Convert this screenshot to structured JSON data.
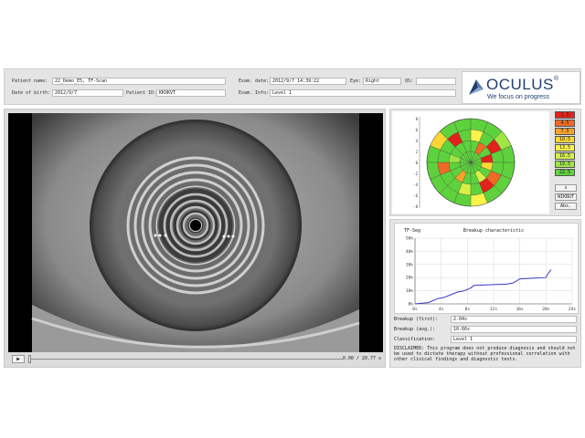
{
  "header": {
    "patient_name_label": "Patient name:",
    "patient_name": "22_Demo_E5, TF-Scan",
    "dob_label": "Date of birth:",
    "dob": "2012/9/7",
    "patient_id_label": "Patient ID:",
    "patient_id": "KKOKVT",
    "exam_date_label": "Exam. date:",
    "exam_date": "2012/9/7 14:39:22",
    "eye_label": "Eye:",
    "eye": "Right",
    "qs_label": "QS:",
    "qs": "",
    "exam_info_label": "Exam. Info:",
    "exam_info": "Level 1"
  },
  "logo": {
    "name": "OCULUS",
    "registered": "®",
    "slogan": "We focus on progress"
  },
  "video": {
    "play_symbol": "▶",
    "time": "0.00 / 20.77 s",
    "progress": 0
  },
  "topography": {
    "legend": [
      {
        "label": "1.5",
        "color": "#e2231a"
      },
      {
        "label": "4.5",
        "color": "#f06a25"
      },
      {
        "label": "7.5",
        "color": "#f6a12c"
      },
      {
        "label": "10.5",
        "color": "#fcd734"
      },
      {
        "label": "13.5",
        "color": "#fbf24a"
      },
      {
        "label": "16.5",
        "color": "#d6ef45"
      },
      {
        "label": "19.5",
        "color": "#9ee543"
      },
      {
        "label": "22.5",
        "color": "#5ed23c"
      }
    ],
    "buttons": [
      "s",
      "NIKBUT",
      "Abs."
    ],
    "axis_ticks": [
      "8",
      "6",
      "4",
      "2",
      "0",
      "-2",
      "-4",
      "-6",
      "-8"
    ]
  },
  "breakup": {
    "tag": "TF-Seg",
    "title": "Breakup characteristic",
    "first_label": "Breakup (first):",
    "first_value": "2.04s",
    "avg_label": "Breakup (avg.):",
    "avg_value": "10.66s",
    "class_label": "Classification:",
    "class_value": "Level 1",
    "disclaimer": "DISCLAIMER: This program does not produce diagnosis and should not be used to dictate therapy without professional correlation with other clinical findings and diagnostic tests."
  },
  "chart_data": {
    "type": "line",
    "title": "Breakup characteristic",
    "ylabel": "TF-Seg",
    "xlabel": "",
    "x_ticks": [
      "0s",
      "4s",
      "8s",
      "12s",
      "16s",
      "20s",
      "24s"
    ],
    "y_ticks": [
      "0%",
      "10%",
      "20%",
      "30%",
      "40%",
      "50%"
    ],
    "xlim": [
      0,
      24
    ],
    "ylim": [
      0,
      50
    ],
    "grid": true,
    "series": [
      {
        "color": "#3a3ac8",
        "x": [
          0,
          2.04,
          2.5,
          3.0,
          3.5,
          4.5,
          5.0,
          5.5,
          6.0,
          6.5,
          7.5,
          8.0,
          8.5,
          9.0,
          14.0,
          15.0,
          16.0,
          20.0,
          20.3,
          20.77
        ],
        "y": [
          0,
          1,
          2,
          3,
          4,
          5,
          6,
          7,
          8,
          9,
          10,
          11,
          12,
          14,
          15,
          16,
          19,
          20,
          23,
          26
        ]
      }
    ]
  }
}
